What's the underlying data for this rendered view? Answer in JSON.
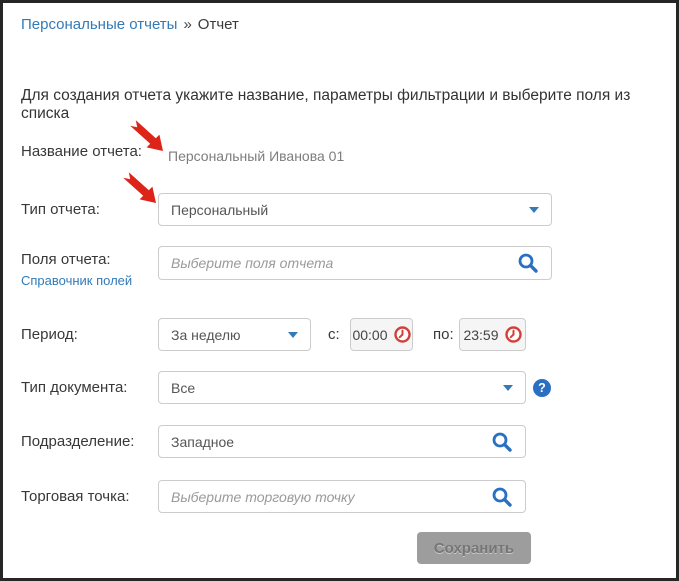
{
  "breadcrumb": {
    "link": "Персональные отчеты",
    "separator": "»",
    "current": "Отчет"
  },
  "intro": "Для создания отчета укажите название, параметры фильтрации и выберите поля из списка",
  "form": {
    "report_name": {
      "label": "Название отчета:",
      "value": "Персональный Иванова 01"
    },
    "report_type": {
      "label": "Тип отчета:",
      "value": "Персональный"
    },
    "report_fields": {
      "label": "Поля отчета:",
      "dictionary_link": "Справочник полей",
      "placeholder": "Выберите поля отчета"
    },
    "period": {
      "label": "Период:",
      "value": "За неделю",
      "from_label": "с:",
      "from_value": "00:00",
      "to_label": "по:",
      "to_value": "23:59"
    },
    "document_type": {
      "label": "Тип документа:",
      "value": "Все",
      "help_glyph": "?"
    },
    "division": {
      "label": "Подразделение:",
      "value": "Западное"
    },
    "outlet": {
      "label": "Торговая точка:",
      "placeholder": "Выберите торговую точку"
    }
  },
  "save_button": "Сохранить",
  "colors": {
    "link_blue": "#337ab7",
    "icon_blue": "#2a70c2",
    "clock_red": "#d43f3a",
    "arrow_red": "#dd2418",
    "button_gray": "#9d9d9d"
  }
}
